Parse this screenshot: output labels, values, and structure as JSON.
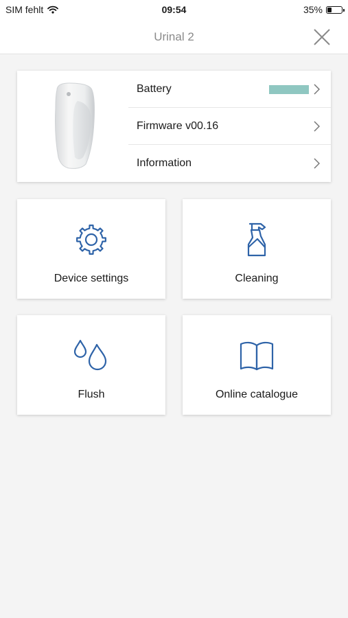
{
  "status_bar": {
    "carrier": "SIM fehlt",
    "time": "09:54",
    "battery_percent": "35%",
    "battery_level": 0.35
  },
  "header": {
    "title": "Urinal 2",
    "close_icon": "close-icon"
  },
  "info_card": {
    "rows": [
      {
        "label": "Battery",
        "battery_level": 1.0
      },
      {
        "label": "Firmware v00.16"
      },
      {
        "label": "Information"
      }
    ]
  },
  "tiles": [
    {
      "label": "Device settings",
      "icon": "gear-icon"
    },
    {
      "label": "Cleaning",
      "icon": "spray-bottle-icon"
    },
    {
      "label": "Flush",
      "icon": "water-drops-icon"
    },
    {
      "label": "Online catalogue",
      "icon": "open-book-icon"
    }
  ],
  "colors": {
    "accent_blue": "#2e63a8",
    "battery_teal": "#8fc7c1",
    "header_title": "#8a8a8a",
    "background": "#f4f4f4"
  }
}
